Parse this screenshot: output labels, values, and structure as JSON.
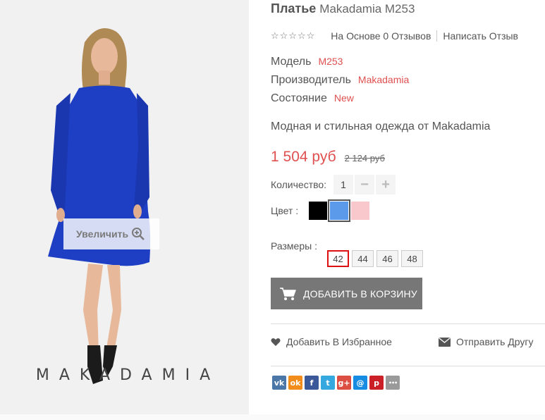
{
  "product": {
    "title_main": "Платье",
    "title_model": "Makadamia M253",
    "rating_stars": "☆☆☆☆☆",
    "reviews_text": "На Основе 0 Отзывов",
    "write_review": "Написать Отзыв",
    "attributes": [
      {
        "label": "Модель",
        "value": "M253"
      },
      {
        "label": "Производитель",
        "value": "Makadamia"
      },
      {
        "label": "Состояние",
        "value": "New"
      }
    ],
    "description": "Модная и стильная одежда от Makadamia",
    "price": "1 504 руб",
    "old_price": "2 124 руб",
    "quantity_label": "Количество:",
    "quantity_value": "1",
    "qty_minus": "−",
    "qty_plus": "+",
    "color_label": "Цвет :",
    "colors": [
      "#000000",
      "#5b9aea",
      "#f8c8cc"
    ],
    "selected_color_index": 1,
    "sizes_label": "Размеры :",
    "sizes": [
      "42",
      "44",
      "46",
      "48"
    ],
    "selected_size": "42",
    "add_to_cart": "ДОБАВИТЬ В КОРЗИНУ",
    "wishlist": "Добавить В Избранное",
    "send_friend": "Отправить Другу"
  },
  "image": {
    "zoom_label": "Увеличить",
    "brand_watermark": "MAKADAMIA",
    "dress_color": "#1e3fc4"
  },
  "share": [
    {
      "icon": "vk-icon",
      "glyph": "vk",
      "color": "#4a76a8"
    },
    {
      "icon": "odnoklassniki-icon",
      "glyph": "ok",
      "color": "#f28c1b"
    },
    {
      "icon": "facebook-icon",
      "glyph": "f",
      "color": "#3b5998"
    },
    {
      "icon": "twitter-icon",
      "glyph": "t",
      "color": "#35a8e0"
    },
    {
      "icon": "googleplus-icon",
      "glyph": "g+",
      "color": "#dc4e41"
    },
    {
      "icon": "mailru-icon",
      "glyph": "@",
      "color": "#168de2"
    },
    {
      "icon": "pinterest-icon",
      "glyph": "p",
      "color": "#cb2027"
    },
    {
      "icon": "more-icon",
      "glyph": "•••",
      "color": "#9a9a9a"
    }
  ]
}
